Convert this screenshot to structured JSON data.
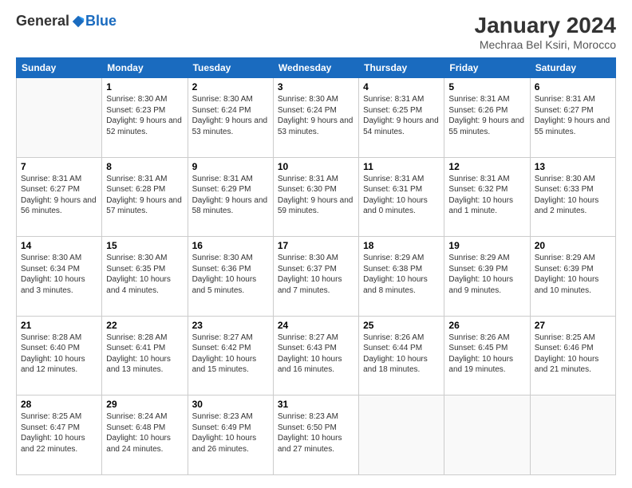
{
  "header": {
    "logo_general": "General",
    "logo_blue": "Blue",
    "title": "January 2024",
    "subtitle": "Mechraa Bel Ksiri, Morocco"
  },
  "columns": [
    "Sunday",
    "Monday",
    "Tuesday",
    "Wednesday",
    "Thursday",
    "Friday",
    "Saturday"
  ],
  "weeks": [
    [
      {
        "day": "",
        "sunrise": "",
        "sunset": "",
        "daylight": ""
      },
      {
        "day": "1",
        "sunrise": "Sunrise: 8:30 AM",
        "sunset": "Sunset: 6:23 PM",
        "daylight": "Daylight: 9 hours and 52 minutes."
      },
      {
        "day": "2",
        "sunrise": "Sunrise: 8:30 AM",
        "sunset": "Sunset: 6:24 PM",
        "daylight": "Daylight: 9 hours and 53 minutes."
      },
      {
        "day": "3",
        "sunrise": "Sunrise: 8:30 AM",
        "sunset": "Sunset: 6:24 PM",
        "daylight": "Daylight: 9 hours and 53 minutes."
      },
      {
        "day": "4",
        "sunrise": "Sunrise: 8:31 AM",
        "sunset": "Sunset: 6:25 PM",
        "daylight": "Daylight: 9 hours and 54 minutes."
      },
      {
        "day": "5",
        "sunrise": "Sunrise: 8:31 AM",
        "sunset": "Sunset: 6:26 PM",
        "daylight": "Daylight: 9 hours and 55 minutes."
      },
      {
        "day": "6",
        "sunrise": "Sunrise: 8:31 AM",
        "sunset": "Sunset: 6:27 PM",
        "daylight": "Daylight: 9 hours and 55 minutes."
      }
    ],
    [
      {
        "day": "7",
        "sunrise": "Sunrise: 8:31 AM",
        "sunset": "Sunset: 6:27 PM",
        "daylight": "Daylight: 9 hours and 56 minutes."
      },
      {
        "day": "8",
        "sunrise": "Sunrise: 8:31 AM",
        "sunset": "Sunset: 6:28 PM",
        "daylight": "Daylight: 9 hours and 57 minutes."
      },
      {
        "day": "9",
        "sunrise": "Sunrise: 8:31 AM",
        "sunset": "Sunset: 6:29 PM",
        "daylight": "Daylight: 9 hours and 58 minutes."
      },
      {
        "day": "10",
        "sunrise": "Sunrise: 8:31 AM",
        "sunset": "Sunset: 6:30 PM",
        "daylight": "Daylight: 9 hours and 59 minutes."
      },
      {
        "day": "11",
        "sunrise": "Sunrise: 8:31 AM",
        "sunset": "Sunset: 6:31 PM",
        "daylight": "Daylight: 10 hours and 0 minutes."
      },
      {
        "day": "12",
        "sunrise": "Sunrise: 8:31 AM",
        "sunset": "Sunset: 6:32 PM",
        "daylight": "Daylight: 10 hours and 1 minute."
      },
      {
        "day": "13",
        "sunrise": "Sunrise: 8:30 AM",
        "sunset": "Sunset: 6:33 PM",
        "daylight": "Daylight: 10 hours and 2 minutes."
      }
    ],
    [
      {
        "day": "14",
        "sunrise": "Sunrise: 8:30 AM",
        "sunset": "Sunset: 6:34 PM",
        "daylight": "Daylight: 10 hours and 3 minutes."
      },
      {
        "day": "15",
        "sunrise": "Sunrise: 8:30 AM",
        "sunset": "Sunset: 6:35 PM",
        "daylight": "Daylight: 10 hours and 4 minutes."
      },
      {
        "day": "16",
        "sunrise": "Sunrise: 8:30 AM",
        "sunset": "Sunset: 6:36 PM",
        "daylight": "Daylight: 10 hours and 5 minutes."
      },
      {
        "day": "17",
        "sunrise": "Sunrise: 8:30 AM",
        "sunset": "Sunset: 6:37 PM",
        "daylight": "Daylight: 10 hours and 7 minutes."
      },
      {
        "day": "18",
        "sunrise": "Sunrise: 8:29 AM",
        "sunset": "Sunset: 6:38 PM",
        "daylight": "Daylight: 10 hours and 8 minutes."
      },
      {
        "day": "19",
        "sunrise": "Sunrise: 8:29 AM",
        "sunset": "Sunset: 6:39 PM",
        "daylight": "Daylight: 10 hours and 9 minutes."
      },
      {
        "day": "20",
        "sunrise": "Sunrise: 8:29 AM",
        "sunset": "Sunset: 6:39 PM",
        "daylight": "Daylight: 10 hours and 10 minutes."
      }
    ],
    [
      {
        "day": "21",
        "sunrise": "Sunrise: 8:28 AM",
        "sunset": "Sunset: 6:40 PM",
        "daylight": "Daylight: 10 hours and 12 minutes."
      },
      {
        "day": "22",
        "sunrise": "Sunrise: 8:28 AM",
        "sunset": "Sunset: 6:41 PM",
        "daylight": "Daylight: 10 hours and 13 minutes."
      },
      {
        "day": "23",
        "sunrise": "Sunrise: 8:27 AM",
        "sunset": "Sunset: 6:42 PM",
        "daylight": "Daylight: 10 hours and 15 minutes."
      },
      {
        "day": "24",
        "sunrise": "Sunrise: 8:27 AM",
        "sunset": "Sunset: 6:43 PM",
        "daylight": "Daylight: 10 hours and 16 minutes."
      },
      {
        "day": "25",
        "sunrise": "Sunrise: 8:26 AM",
        "sunset": "Sunset: 6:44 PM",
        "daylight": "Daylight: 10 hours and 18 minutes."
      },
      {
        "day": "26",
        "sunrise": "Sunrise: 8:26 AM",
        "sunset": "Sunset: 6:45 PM",
        "daylight": "Daylight: 10 hours and 19 minutes."
      },
      {
        "day": "27",
        "sunrise": "Sunrise: 8:25 AM",
        "sunset": "Sunset: 6:46 PM",
        "daylight": "Daylight: 10 hours and 21 minutes."
      }
    ],
    [
      {
        "day": "28",
        "sunrise": "Sunrise: 8:25 AM",
        "sunset": "Sunset: 6:47 PM",
        "daylight": "Daylight: 10 hours and 22 minutes."
      },
      {
        "day": "29",
        "sunrise": "Sunrise: 8:24 AM",
        "sunset": "Sunset: 6:48 PM",
        "daylight": "Daylight: 10 hours and 24 minutes."
      },
      {
        "day": "30",
        "sunrise": "Sunrise: 8:23 AM",
        "sunset": "Sunset: 6:49 PM",
        "daylight": "Daylight: 10 hours and 26 minutes."
      },
      {
        "day": "31",
        "sunrise": "Sunrise: 8:23 AM",
        "sunset": "Sunset: 6:50 PM",
        "daylight": "Daylight: 10 hours and 27 minutes."
      },
      {
        "day": "",
        "sunrise": "",
        "sunset": "",
        "daylight": ""
      },
      {
        "day": "",
        "sunrise": "",
        "sunset": "",
        "daylight": ""
      },
      {
        "day": "",
        "sunrise": "",
        "sunset": "",
        "daylight": ""
      }
    ]
  ]
}
